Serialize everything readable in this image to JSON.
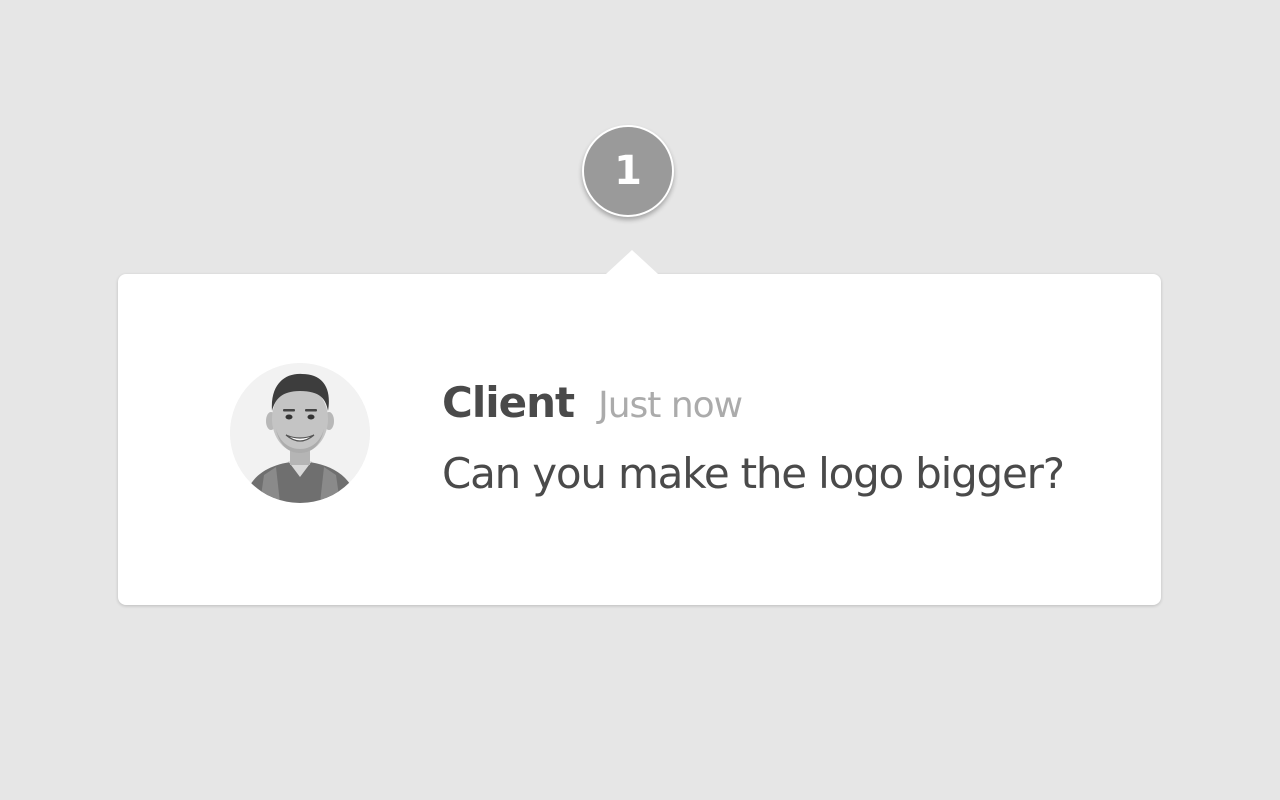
{
  "pin": {
    "number": "1"
  },
  "comment": {
    "author": "Client",
    "timestamp": "Just now",
    "message": "Can you make the logo bigger?",
    "avatar_icon": "user-photo-avatar"
  },
  "colors": {
    "background": "#e6e6e6",
    "card": "#ffffff",
    "pin": "#9a9a9a",
    "author_text": "#4a4a4a",
    "timestamp_text": "#ababab"
  }
}
